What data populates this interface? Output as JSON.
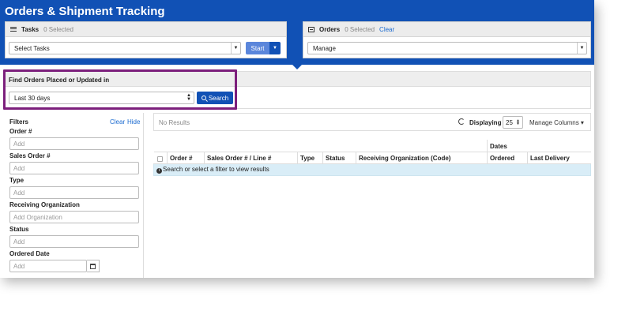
{
  "app": {
    "title": "Orders & Shipment Tracking"
  },
  "tasks_panel": {
    "title": "Tasks",
    "count": "0 Selected",
    "select_value": "Select Tasks",
    "start_label": "Start"
  },
  "orders_panel": {
    "title": "Orders",
    "count": "0 Selected",
    "clear_label": "Clear",
    "select_value": "Manage"
  },
  "find": {
    "label": "Find Orders Placed or Updated in",
    "range_value": "Last 30 days",
    "search_label": "Search"
  },
  "filters": {
    "title": "Filters",
    "clear_label": "Clear",
    "hide_label": "Hide",
    "fields": [
      {
        "label": "Order #",
        "placeholder": "Add"
      },
      {
        "label": "Sales Order #",
        "placeholder": "Add"
      },
      {
        "label": "Type",
        "placeholder": "Add"
      },
      {
        "label": "Receiving Organization",
        "placeholder": "Add Organization"
      },
      {
        "label": "Status",
        "placeholder": "Add"
      },
      {
        "label": "Ordered Date",
        "placeholder": "Add"
      }
    ]
  },
  "results": {
    "status_text": "No Results",
    "displaying_label": "Displaying",
    "page_size": "25",
    "manage_columns_label": "Manage Columns",
    "group_header": "Dates",
    "columns": [
      "Order #",
      "Sales Order # / Line #",
      "Type",
      "Status",
      "Receiving Organization (Code)",
      "Ordered",
      "Last Delivery"
    ],
    "empty_message": "Search or select a filter to view results"
  }
}
